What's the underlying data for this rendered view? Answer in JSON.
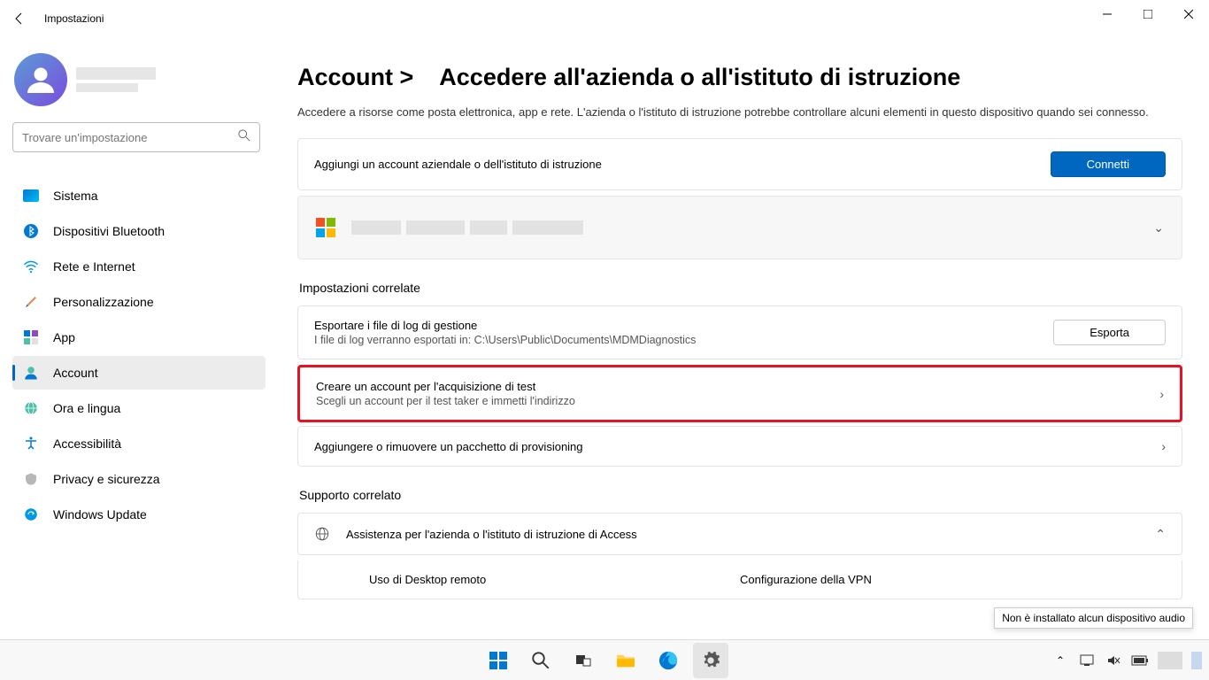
{
  "window": {
    "title": "Impostazioni"
  },
  "search": {
    "placeholder": "Trovare un'impostazione"
  },
  "nav": {
    "system": "Sistema",
    "bluetooth": "Dispositivi Bluetooth",
    "network": "Rete e Internet",
    "personalization": "Personalizzazione",
    "apps": "App",
    "accounts": "Account",
    "time": "Ora e lingua",
    "accessibility": "Accessibilità",
    "privacy": "Privacy e sicurezza",
    "update": "Windows Update"
  },
  "header": {
    "crumb_root": "Account >",
    "crumb_page": "Accedere all'azienda o all'istituto di istruzione",
    "description": "Accedere a risorse come posta elettronica, app e rete. L'azienda o l'istituto di istruzione potrebbe controllare alcuni elementi in questo dispositivo quando sei connesso."
  },
  "cards": {
    "add_account": "Aggiungi un account aziendale o dell'istituto di istruzione",
    "connect_btn": "Connetti",
    "related_label": "Impostazioni correlate",
    "export_title": "Esportare i file di log di gestione",
    "export_sub": "I file di log verranno esportati in: C:\\Users\\Public\\Documents\\MDMDiagnostics",
    "export_btn": "Esporta",
    "test_title": "Creare un account per l'acquisizione di test",
    "test_sub": "Scegli un account per il test taker e immetti l'indirizzo",
    "provisioning": "Aggiungere o rimuovere un pacchetto di provisioning",
    "support_label": "Supporto correlato",
    "support_title": "Assistenza per l'azienda o l'istituto di istruzione di Access",
    "support_col1": "Uso di Desktop remoto",
    "support_col2": "Configurazione della VPN"
  },
  "tooltip": "Non è installato alcun dispositivo audio"
}
